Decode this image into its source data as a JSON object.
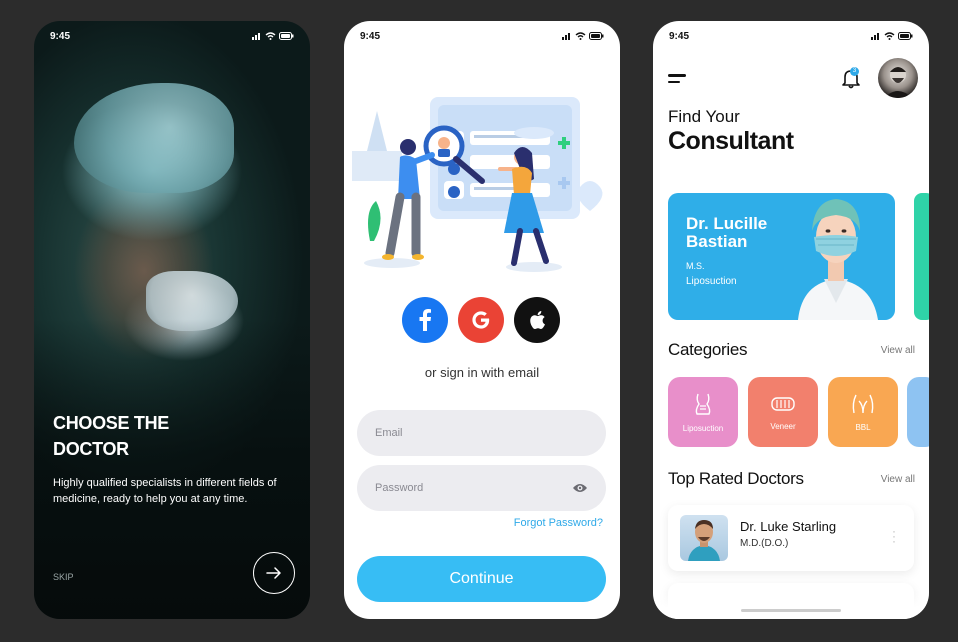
{
  "status_time": "9:45",
  "onboarding": {
    "title_line1": "CHOOSE THE",
    "title_line2": "DOCTOR",
    "description": "Highly qualified specialists in different fields of medicine, ready to help you at any time.",
    "skip": "SKIP",
    "next_icon": "arrow-right-icon"
  },
  "login": {
    "social": [
      "facebook-icon",
      "google-icon",
      "apple-icon"
    ],
    "or_text": "or sign in with email",
    "email_placeholder": "Email",
    "password_placeholder": "Password",
    "forgot": "Forgot Password?",
    "continue": "Continue",
    "accent": "#37bdf4"
  },
  "home": {
    "notification_count": "3",
    "find_your": "Find Your",
    "consultant": "Consultant",
    "featured": {
      "name": "Dr. Lucille Bastian",
      "degree": "M.S.",
      "specialty": "Liposuction",
      "color": "#2faee8"
    },
    "categories_title": "Categories",
    "view_all": "View all",
    "categories": [
      {
        "label": "Liposuction",
        "color": "#e88fca"
      },
      {
        "label": "Veneer",
        "color": "#f2806d"
      },
      {
        "label": "BBL",
        "color": "#f9a752"
      }
    ],
    "top_rated_title": "Top Rated Doctors",
    "top_doctor": {
      "name": "Dr. Luke Starling",
      "degree": "M.D.(D.O.)"
    }
  }
}
